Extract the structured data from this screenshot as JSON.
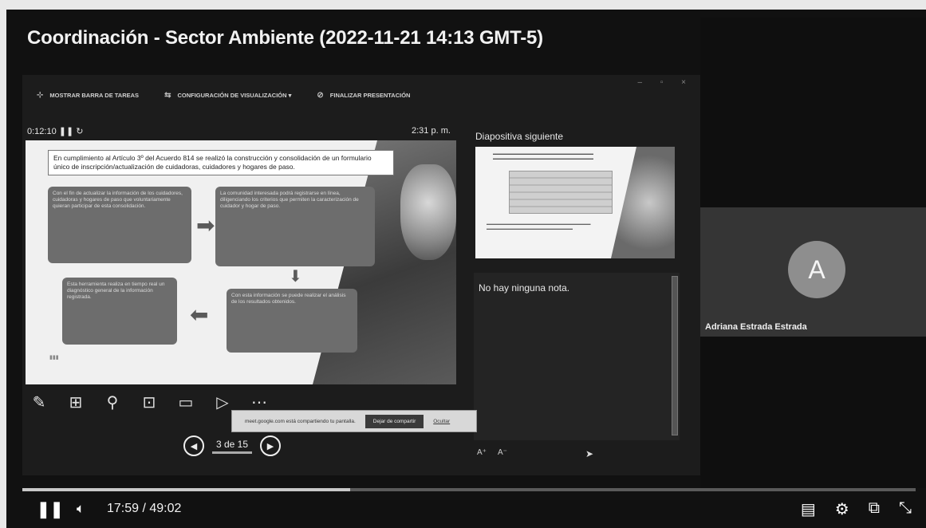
{
  "video": {
    "title": "Coordinación - Sector Ambiente (2022-11-21 14:13 GMT-5)",
    "current_time": "17:59",
    "duration": "49:02",
    "time_display": "17:59 / 49:02",
    "progress": 0.367
  },
  "presenter_view": {
    "toolbar": {
      "show_taskbar": "MOSTRAR BARRA DE TAREAS",
      "display_settings": "CONFIGURACIÓN DE VISUALIZACIÓN ▾",
      "end_presentation": "FINALIZAR PRESENTACIÓN"
    },
    "timer": "0:12:10",
    "clock": "2:31 p. m.",
    "current_slide": {
      "intro": "En cumplimiento al Artículo 3º del Acuerdo 814 se realizó la construcción y consolidación de un formulario único de inscripción/actualización de cuidadoras, cuidadores y hogares de paso.",
      "box1": "Con el fin de actualizar la información de los cuidadores, cuidadoras y hogares de paso que voluntariamente quieran participar de esta consolidación.",
      "box2": "La comunidad interesada podrá registrarse en línea, diligenciando los criterios que permiten la caracterización de cuidador y hogar de paso.",
      "box3": "Esta herramienta realiza en tiempo real un diagnóstico general de la información registrada.",
      "box4": "Con esta información se puede realizar el análisis de los resultados obtenidos."
    },
    "next_slide_label": "Diapositiva siguiente",
    "notes": "No hay ninguna nota.",
    "font_controls": [
      "A⁺",
      "A⁻"
    ],
    "pager": "3 de 15",
    "share_bar": {
      "message": "meet.google.com está compartiendo tu pantalla.",
      "stop_label": "Dejar de compartir",
      "hide_label": "Ocultar"
    }
  },
  "participant": {
    "initial": "A",
    "name": "Adriana Estrada Estrada"
  },
  "icons": {
    "pause": "pause-icon",
    "volume": "volume-icon",
    "captions": "captions-icon",
    "settings": "gear-icon",
    "miniplayer": "miniplayer-icon",
    "exit_fullscreen": "exit-fullscreen-icon"
  }
}
